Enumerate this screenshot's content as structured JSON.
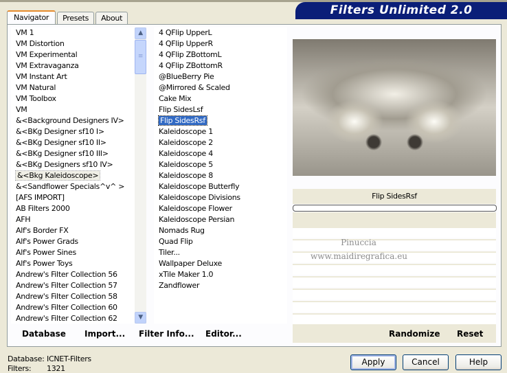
{
  "title": "Filters Unlimited 2.0",
  "tabs": [
    "Navigator",
    "Presets",
    "About"
  ],
  "categories": [
    "VM 1",
    "VM Distortion",
    "VM Experimental",
    "VM Extravaganza",
    "VM Instant Art",
    "VM Natural",
    "VM Toolbox",
    "VM",
    "&<Background Designers IV>",
    "&<BKg Designer sf10 I>",
    "&<BKg Designer sf10 II>",
    "&<BKg Designer sf10 III>",
    "&<BKg Designers sf10 IV>",
    "&<Bkg Kaleidoscope>",
    "&<Sandflower Specials^v^ >",
    "[AFS IMPORT]",
    "AB Filters 2000",
    "AFH",
    "Alf's Border FX",
    "Alf's Power Grads",
    "Alf's Power Sines",
    "Alf's Power Toys",
    "Andrew's Filter Collection 56",
    "Andrew's Filter Collection 57",
    "Andrew's Filter Collection 58",
    "Andrew's Filter Collection 60",
    "Andrew's Filter Collection 62"
  ],
  "selected_category": "&<Bkg Kaleidoscope>",
  "filters": [
    "4 QFlip UpperL",
    "4 QFlip UpperR",
    "4 QFlip ZBottomL",
    "4 QFlip ZBottomR",
    "@BlueBerry Pie",
    "@Mirrored & Scaled",
    "Cake Mix",
    "Flip SidesLsf",
    "Flip SidesRsf",
    "Kaleidoscope 1",
    "Kaleidoscope 2",
    "Kaleidoscope 4",
    "Kaleidoscope 5",
    "Kaleidoscope 8",
    "Kaleidoscope Butterfly",
    "Kaleidoscope Divisions",
    "Kaleidoscope Flower",
    "Kaleidoscope Persian",
    "Nomads Rug",
    "Quad Flip",
    "Tiler...",
    "Wallpaper Deluxe",
    "xTile Maker 1.0",
    "Zandflower"
  ],
  "selected_filter": "Flip SidesRsf",
  "filter_name": "Flip SidesRsf",
  "watermark": [
    "Pinuccia",
    "www.maidiregrafica.eu"
  ],
  "bottom_links": {
    "database": "Database",
    "import": "Import...",
    "filter_info": "Filter Info...",
    "editor": "Editor...",
    "randomize": "Randomize",
    "reset": "Reset"
  },
  "status": {
    "database_label": "Database:",
    "database_value": "ICNET-Filters",
    "filters_label": "Filters:",
    "filters_value": "1321"
  },
  "buttons": {
    "apply": "Apply",
    "cancel": "Cancel",
    "help": "Help"
  }
}
